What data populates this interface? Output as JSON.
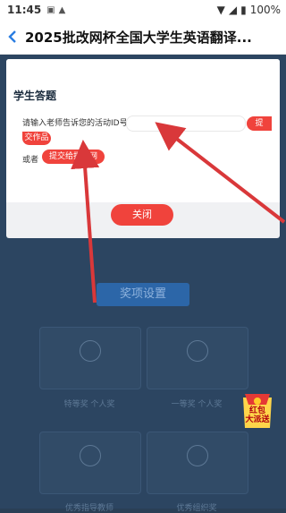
{
  "status": {
    "time": "11:45",
    "battery": "100%"
  },
  "nav": {
    "title": "2025批改网杯全国大学生英语翻译..."
  },
  "dialog": {
    "title": "学生答题",
    "prompt": "请输入老师告诉您的活动ID号",
    "input_value": "",
    "submit_label_part1": "提",
    "submit_label_part2": "交作品",
    "or_label": "或者",
    "submit_to_pigai": "提交给批改网",
    "close_label": "关闭"
  },
  "background": {
    "section_label": "奖项设置",
    "cards": [
      "特等奖 个人奖",
      "一等奖 个人奖",
      "优秀指导教师",
      "优秀组织奖"
    ]
  },
  "redpacket": {
    "line1": "红包",
    "line2": "大派送"
  },
  "colors": {
    "accent": "#f0433c",
    "arrow": "#d9383a"
  }
}
